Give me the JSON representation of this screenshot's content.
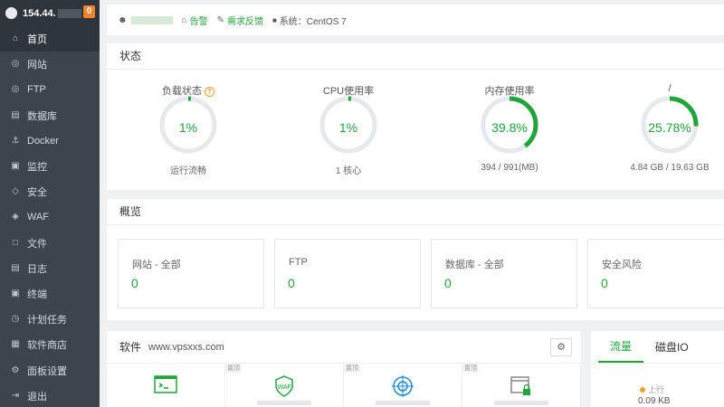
{
  "sidebar": {
    "server_ip": "154.44.",
    "badge": "0",
    "items": [
      {
        "label": "首页",
        "icon": "home-icon",
        "active": true
      },
      {
        "label": "网站",
        "icon": "globe-icon"
      },
      {
        "label": "FTP",
        "icon": "ftp-icon"
      },
      {
        "label": "数据库",
        "icon": "database-icon"
      },
      {
        "label": "Docker",
        "icon": "docker-icon"
      },
      {
        "label": "监控",
        "icon": "monitor-icon"
      },
      {
        "label": "安全",
        "icon": "shield-icon"
      },
      {
        "label": "WAF",
        "icon": "waf-icon"
      },
      {
        "label": "文件",
        "icon": "folder-icon"
      },
      {
        "label": "日志",
        "icon": "log-icon"
      },
      {
        "label": "终端",
        "icon": "terminal-icon"
      },
      {
        "label": "计划任务",
        "icon": "clock-icon"
      },
      {
        "label": "软件商店",
        "icon": "store-icon"
      },
      {
        "label": "面板设置",
        "icon": "gear-icon"
      },
      {
        "label": "退出",
        "icon": "logout-icon"
      }
    ]
  },
  "topbar": {
    "alerts": "告警",
    "feedback": "需求反馈",
    "system": "系统：CentOS 7"
  },
  "status": {
    "title": "状态",
    "gauges": [
      {
        "label": "负载状态",
        "value": "1%",
        "percent": 1,
        "foot": "运行流畅",
        "help": "?"
      },
      {
        "label": "CPU使用率",
        "value": "1%",
        "percent": 1,
        "foot": "1 核心"
      },
      {
        "label": "内存使用率",
        "value": "39.8%",
        "percent": 39.8,
        "foot": "394 / 991(MB)"
      },
      {
        "label": "/",
        "value": "25.78%",
        "percent": 25.78,
        "foot": "4.84 GB / 19.63 GB"
      }
    ]
  },
  "overview": {
    "title": "概览",
    "cards": [
      {
        "label": "网站 - 全部",
        "value": "0"
      },
      {
        "label": "FTP",
        "value": "0"
      },
      {
        "label": "数据库 - 全部",
        "value": "0"
      },
      {
        "label": "安全风险",
        "value": "0"
      }
    ]
  },
  "software": {
    "title": "软件",
    "site": "www.vpsxxs.com",
    "pin_label": "置顶",
    "items": [
      {
        "icon": "terminal-icon"
      },
      {
        "icon": "waf-icon"
      },
      {
        "icon": "target-icon"
      },
      {
        "icon": "lock-window-icon"
      }
    ]
  },
  "traffic": {
    "tabs": [
      "流量",
      "磁盘IO"
    ],
    "up_label": "上行",
    "up_value": "0.09 KB"
  },
  "colors": {
    "accent": "#20a53a",
    "sidebar_bg": "#3c444d",
    "badge": "#f0832b"
  }
}
